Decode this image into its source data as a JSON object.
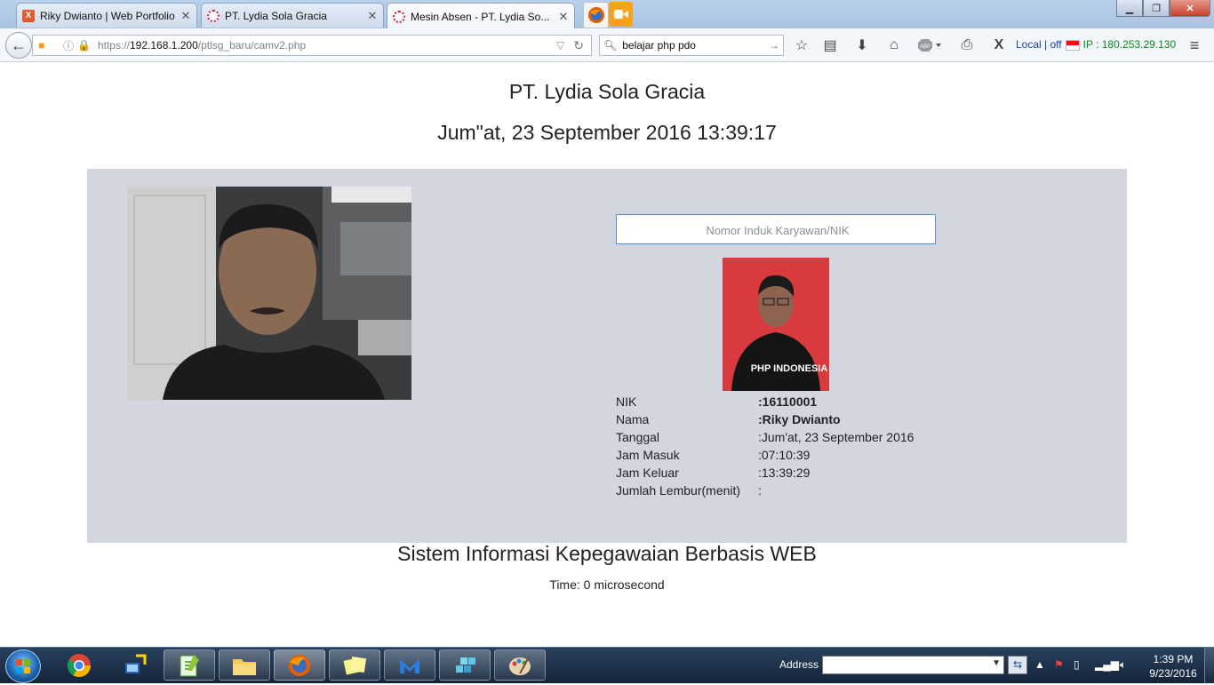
{
  "tabs": [
    {
      "title": "Riky Dwianto | Web Portfolio",
      "active": false
    },
    {
      "title": "PT. Lydia Sola Gracia",
      "active": false
    },
    {
      "title": "Mesin Absen - PT. Lydia So...",
      "active": true
    }
  ],
  "nav": {
    "url_prefix": "https://",
    "url_host": "192.168.1.200",
    "url_path": "/ptlsg_baru/camv2.php",
    "search_value": "belajar php pdo",
    "local_status": "Local | off",
    "ip_text": "IP : 180.253.29.130"
  },
  "page": {
    "company": "PT. Lydia Sola Gracia",
    "datetime": "Jum\"at, 23 September 2016 13:39:17",
    "nik_placeholder": "Nomor Induk Karyawan/NIK",
    "photo_shirt_text": "PHP INDONESIA",
    "info": [
      {
        "label": "NIK",
        "value": ":16110001",
        "bold": true
      },
      {
        "label": "Nama",
        "value": ":Riky Dwianto",
        "bold": true
      },
      {
        "label": "Tanggal",
        "value": ":Jum'at, 23 September 2016",
        "bold": false
      },
      {
        "label": "Jam Masuk",
        "value": ":07:10:39",
        "bold": false
      },
      {
        "label": "Jam Keluar",
        "value": ":13:39:29",
        "bold": false
      },
      {
        "label": "Jumlah Lembur(menit)",
        "value": ":",
        "bold": false
      }
    ],
    "system_name": "Sistem Informasi Kepegawaian Berbasis WEB",
    "time_info": "Time: 0 microsecond"
  },
  "taskbar": {
    "address_label": "Address",
    "clock_time": "1:39 PM",
    "clock_date": "9/23/2016"
  },
  "colors": {
    "panel": "#d2d6df",
    "ip_green": "#0a8a1a",
    "local_blue": "#1a3fb5",
    "photo_red": "#d93a3e"
  }
}
